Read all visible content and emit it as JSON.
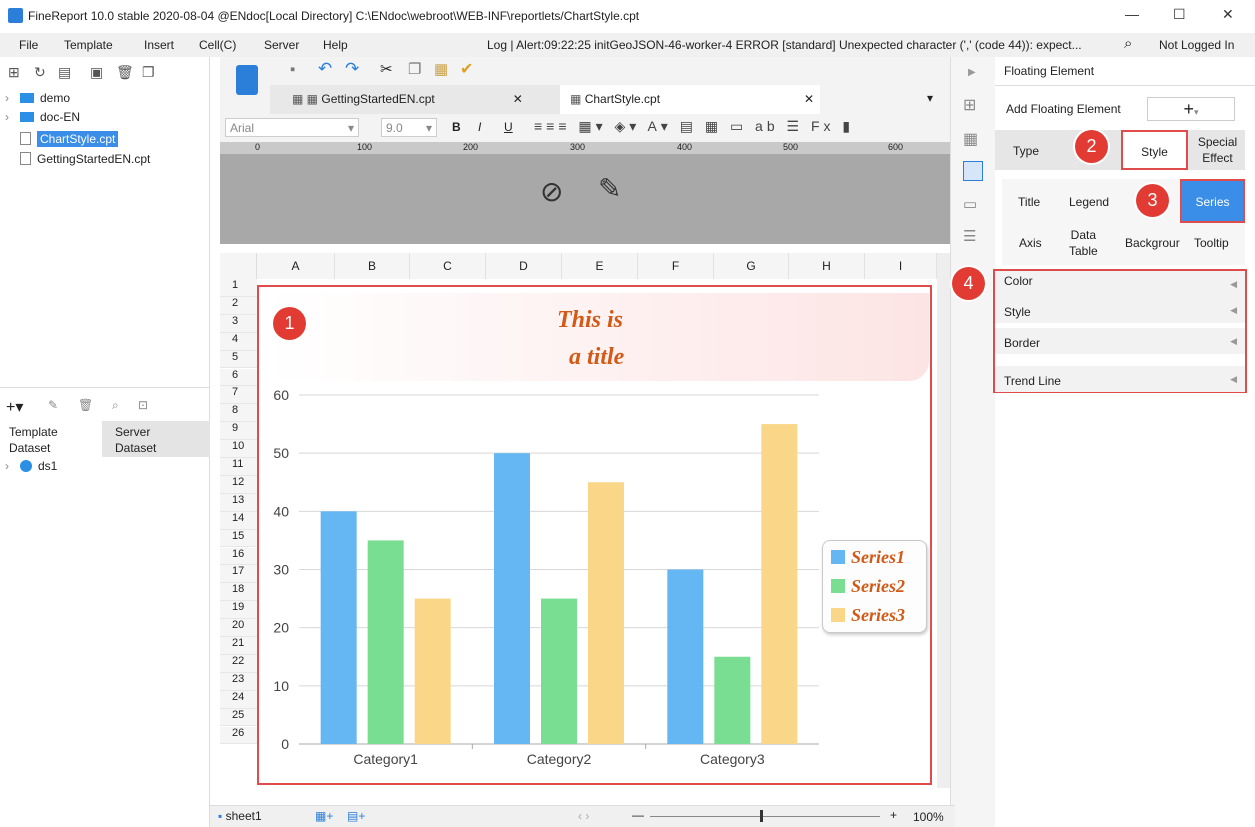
{
  "window": {
    "title": "FineReport 10.0 stable 2020-08-04 @ENdoc[Local Directory]    C:\\ENdoc\\webroot\\WEB-INF\\reportlets/ChartStyle.cpt"
  },
  "menu": {
    "items": [
      "File",
      "Template",
      "Insert",
      "Cell(C)",
      "Server",
      "Help"
    ],
    "log": "Log | Alert:09:22:25 initGeoJSON-46-worker-4 ERROR [standard] Unexpected character (',' (code 44)): expect...",
    "login": "Not Logged In"
  },
  "tree": {
    "items": [
      {
        "label": "demo",
        "type": "folder"
      },
      {
        "label": "doc-EN",
        "type": "folder"
      },
      {
        "label": "ChartStyle.cpt",
        "type": "file",
        "selected": true
      },
      {
        "label": "GettingStartedEN.cpt",
        "type": "file"
      }
    ]
  },
  "dataset": {
    "tab1_a": "Template",
    "tab1_b": "Dataset",
    "tab2_a": "Server",
    "tab2_b": "Dataset",
    "item": "ds1"
  },
  "tabs": [
    {
      "label": "GettingStartedEN.cpt"
    },
    {
      "label": "ChartStyle.cpt"
    }
  ],
  "format": {
    "font": "Arial",
    "size": "9.0"
  },
  "ruler": [
    "0",
    "100",
    "200",
    "300",
    "400",
    "500",
    "600"
  ],
  "columns": [
    "A",
    "B",
    "C",
    "D",
    "E",
    "F",
    "G",
    "H",
    "I"
  ],
  "rows": [
    "1",
    "2",
    "3",
    "4",
    "5",
    "6",
    "7",
    "8",
    "9",
    "10",
    "11",
    "12",
    "13",
    "14",
    "15",
    "16",
    "17",
    "18",
    "19",
    "20",
    "21",
    "22",
    "23",
    "24",
    "25",
    "26"
  ],
  "sheet": {
    "tab": "sheet1",
    "zoom": "100%"
  },
  "chart_data": {
    "type": "bar",
    "title_line1": "This is",
    "title_line2": "a title",
    "categories": [
      "Category1",
      "Category2",
      "Category3"
    ],
    "series": [
      {
        "name": "Series1",
        "values": [
          40,
          50,
          30
        ],
        "color": "#64b7f3"
      },
      {
        "name": "Series2",
        "values": [
          35,
          25,
          15
        ],
        "color": "#79dd92"
      },
      {
        "name": "Series3",
        "values": [
          25,
          45,
          55
        ],
        "color": "#fad688"
      }
    ],
    "yticks": [
      "0",
      "10",
      "20",
      "30",
      "40",
      "50",
      "60"
    ],
    "ylim": [
      0,
      60
    ],
    "legend": "right",
    "grid": true
  },
  "right": {
    "header": "Floating Element",
    "add_label": "Add Floating Element",
    "add_btn": "+",
    "tab_type": "Type",
    "tab_style": "Style",
    "tab_special_a": "Special",
    "tab_special_b": "Effect",
    "sub": {
      "title": "Title",
      "legend": "Legend",
      "series": "Series",
      "axis": "Axis",
      "datatable_a": "Data",
      "datatable_b": "Table",
      "background": "Backgrour",
      "tooltip": "Tooltip"
    },
    "props": [
      "Color",
      "Style",
      "Border",
      "Trend Line"
    ]
  },
  "badges": [
    "1",
    "2",
    "3",
    "4"
  ]
}
